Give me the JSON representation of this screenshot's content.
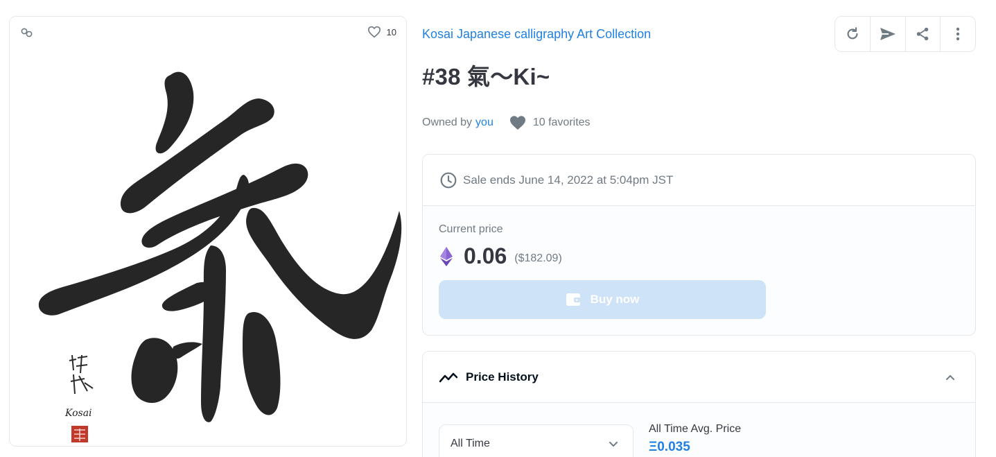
{
  "asset": {
    "favorite_count": "10",
    "collection_name": "Kosai Japanese calligraphy Art Collection",
    "title": "#38 氣〜Ki~",
    "artwork_signature": "Kosai",
    "artwork_character": "氣"
  },
  "owner": {
    "owned_by_label": "Owned by",
    "owner_name": "you",
    "favorites_text": "10 favorites"
  },
  "toolbar": {
    "icons": [
      "refresh-icon",
      "send-icon",
      "share-icon",
      "more-icon"
    ]
  },
  "sale": {
    "ends_text": "Sale ends June 14, 2022 at 5:04pm JST",
    "current_price_label": "Current price",
    "price_eth": "0.06",
    "price_usd": "($182.09)",
    "buy_label": "Buy now"
  },
  "price_history": {
    "title": "Price History",
    "range_selected": "All Time",
    "avg_label": "All Time Avg. Price",
    "avg_value": "Ξ0.035"
  },
  "colors": {
    "link": "#2081e2",
    "text": "#353840",
    "muted": "#707a83",
    "border": "#e5e8eb",
    "buy_disabled": "#cfe3f8",
    "eth": "#8a63d2"
  }
}
